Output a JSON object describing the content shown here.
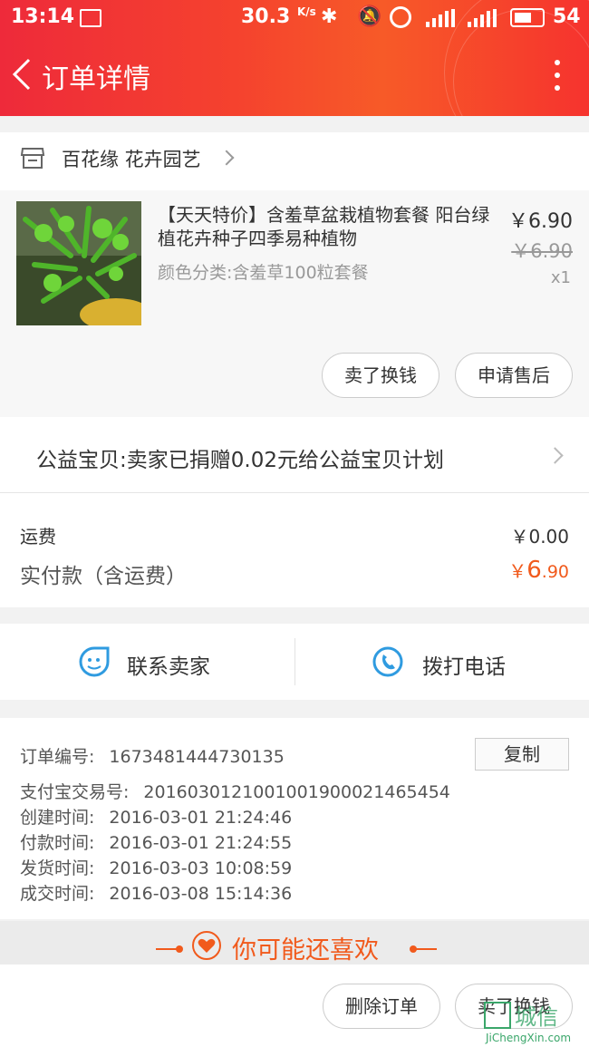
{
  "status_bar": {
    "time": "13:14",
    "speed": "30.3",
    "speed_unit": "K/s",
    "battery": "54"
  },
  "header": {
    "title": "订单详情"
  },
  "shop": {
    "name": "百花缘 花卉园艺"
  },
  "product": {
    "title": "【天天特价】含羞草盆栽植物套餐 阳台绿植花卉种子四季易种植物",
    "sku": "颜色分类:含羞草100粒套餐",
    "price": "￥6.90",
    "original_price": "￥6.90",
    "quantity": "x1",
    "sell_button": "卖了换钱",
    "after_sale_button": "申请售后"
  },
  "charity": {
    "text": "公益宝贝:卖家已捐赠0.02元给公益宝贝计划"
  },
  "fee": {
    "shipping_label": "运费",
    "shipping_value": "￥0.00",
    "paid_label": "实付款（含运费）",
    "paid_currency": "￥",
    "paid_int": "6",
    "paid_dec": ".90"
  },
  "contact": {
    "seller_label": "联系卖家",
    "call_label": "拨打电话"
  },
  "order_info": {
    "copy_button": "复制",
    "rows": [
      {
        "key": "订单编号:",
        "value": "1673481444730135"
      },
      {
        "key": "支付宝交易号:",
        "value": "2016030121001001900021465454"
      },
      {
        "key": "创建时间:",
        "value": "2016-03-01 21:24:46"
      },
      {
        "key": "付款时间:",
        "value": "2016-03-01 21:24:55"
      },
      {
        "key": "发货时间:",
        "value": "2016-03-03 10:08:59"
      },
      {
        "key": "成交时间:",
        "value": "2016-03-08 15:14:36"
      }
    ]
  },
  "recommend": {
    "title": "你可能还喜欢"
  },
  "bottom": {
    "delete_button": "删除订单",
    "sell_button": "卖了换钱"
  },
  "watermark": {
    "cn": "城信",
    "en": "JiChengXin.com"
  },
  "colors": {
    "header_red": "#ee2a3a",
    "accent_orange": "#f15a1c"
  }
}
